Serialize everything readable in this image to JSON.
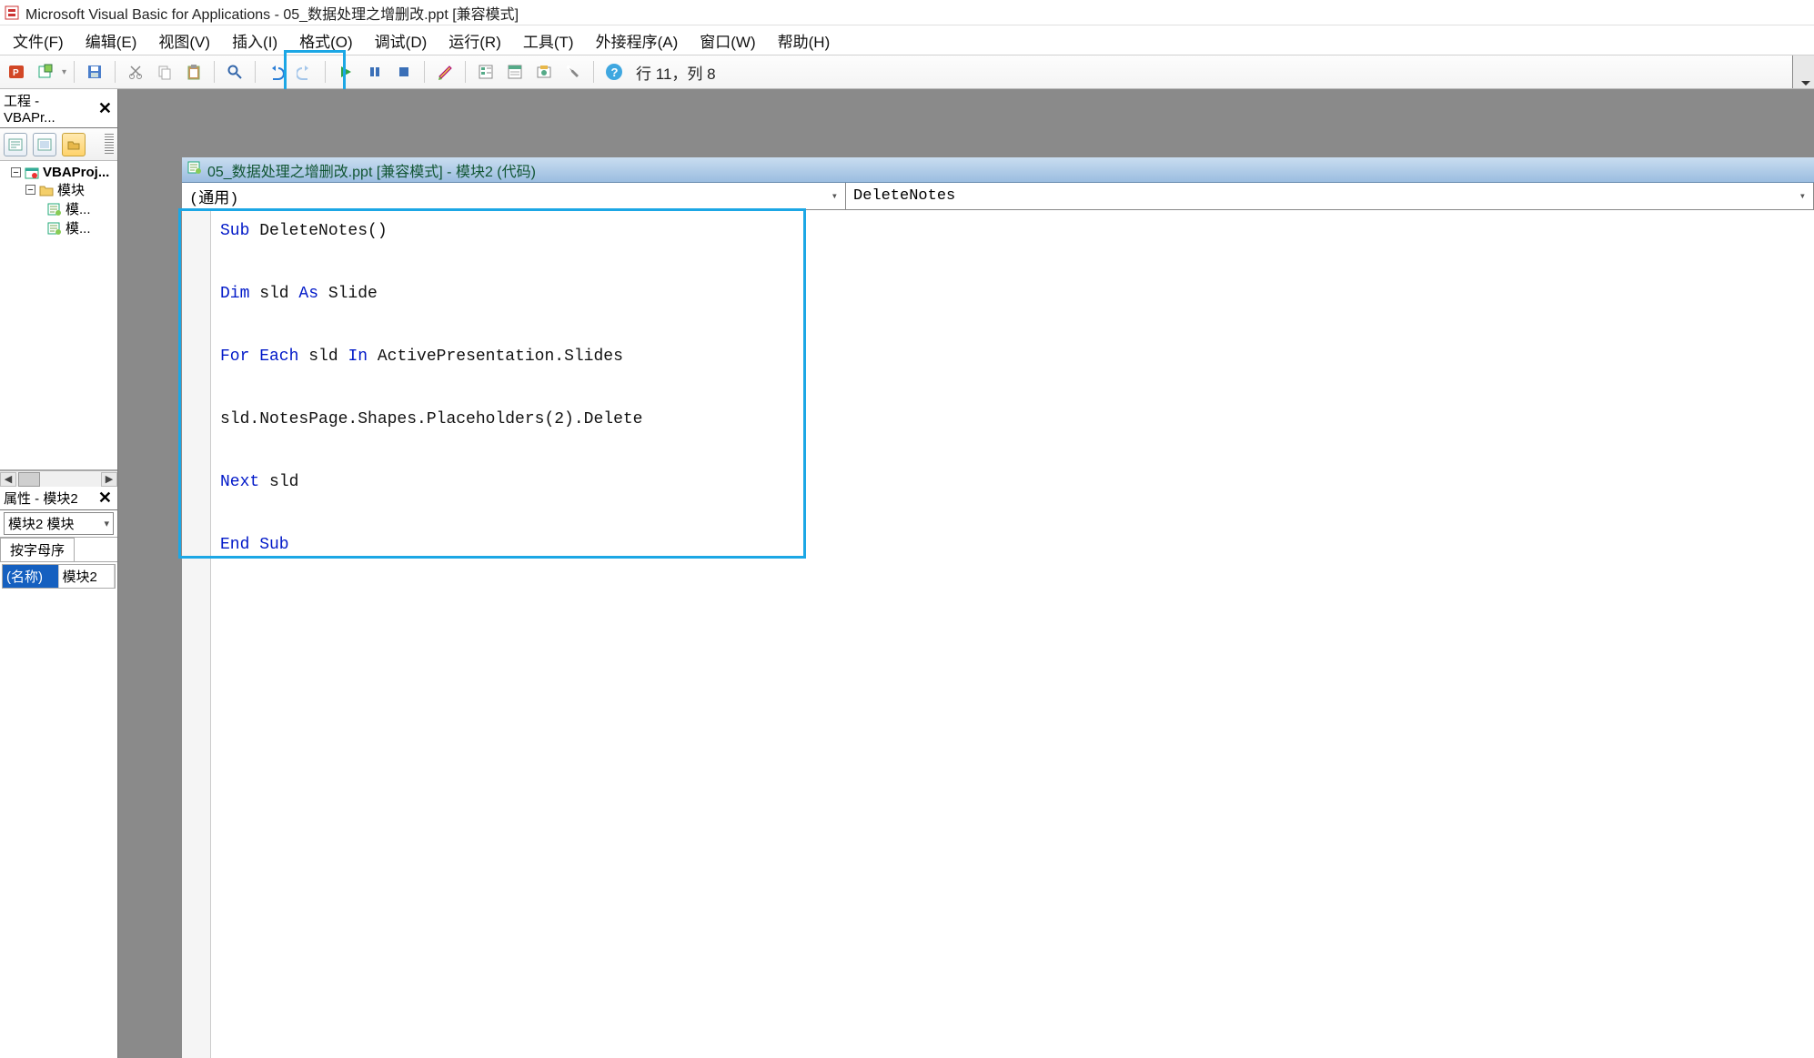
{
  "title": "Microsoft Visual Basic for Applications - 05_数据处理之增删改.ppt [兼容模式]",
  "menus": {
    "file": "文件(F)",
    "edit": "编辑(E)",
    "view": "视图(V)",
    "insert": "插入(I)",
    "format": "格式(O)",
    "debug": "调试(D)",
    "run": "运行(R)",
    "tools": "工具(T)",
    "addins": "外接程序(A)",
    "window": "窗口(W)",
    "help": "帮助(H)"
  },
  "cursor_status": "行 11，列 8",
  "project_explorer": {
    "title": "工程 - VBAPr...",
    "root": "VBAProj...",
    "modules_folder": "模块",
    "module1": "模...",
    "module2": "模..."
  },
  "properties_pane": {
    "title": "属性 - 模块2",
    "object_selector": "模块2 模块",
    "tab_alpha": "按字母序",
    "name_label": "(名称)",
    "name_value": "模块2"
  },
  "code_window": {
    "title": "05_数据处理之增删改.ppt [兼容模式] - 模块2 (代码)",
    "left_dropdown": "(通用)",
    "right_dropdown": "DeleteNotes"
  },
  "code": {
    "l1a": "Sub",
    "l1b": " DeleteNotes()",
    "l2a": "Dim",
    "l2b": " sld ",
    "l2c": "As",
    "l2d": " Slide",
    "l3a": "For Each",
    "l3b": " sld ",
    "l3c": "In",
    "l3d": " ActivePresentation.Slides",
    "l4": "sld.NotesPage.Shapes.Placeholders(2).Delete",
    "l5a": "Next",
    "l5b": " sld",
    "l6": "End Sub"
  }
}
